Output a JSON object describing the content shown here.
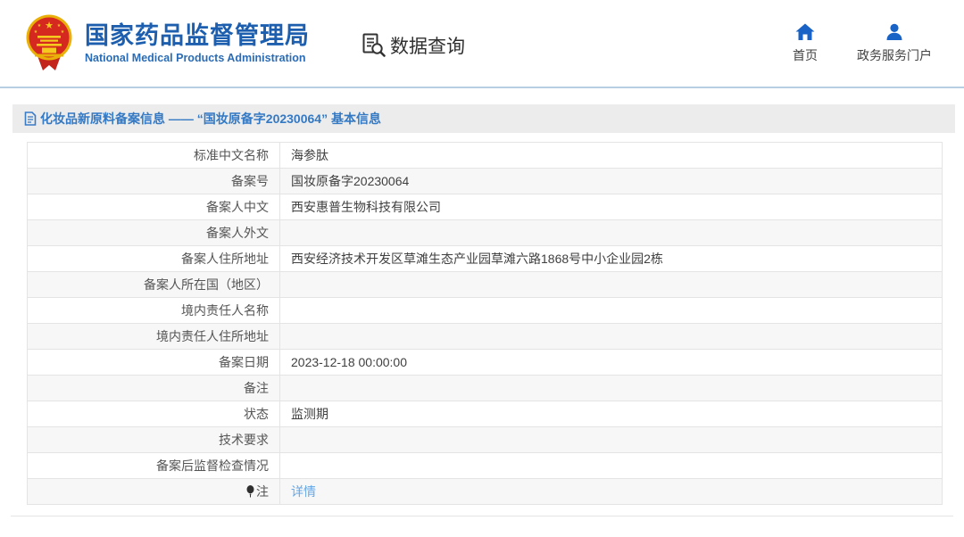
{
  "header": {
    "brand": {
      "title_cn": "国家药品监督管理局",
      "title_en": "National Medical Products Administration"
    },
    "query_title": "数据查询",
    "nav": [
      {
        "label": "首页",
        "icon": "home-icon"
      },
      {
        "label": "政务服务门户",
        "icon": "user-icon"
      }
    ]
  },
  "breadcrumb": {
    "title": "化妆品新原料备案信息 —— “国妆原备字20230064” 基本信息"
  },
  "table": {
    "rows": [
      {
        "label": "标准中文名称",
        "value": "海参肽"
      },
      {
        "label": "备案号",
        "value": "国妆原备字20230064"
      },
      {
        "label": "备案人中文",
        "value": "西安惠普生物科技有限公司"
      },
      {
        "label": "备案人外文",
        "value": ""
      },
      {
        "label": "备案人住所地址",
        "value": "西安经济技术开发区草滩生态产业园草滩六路1868号中小企业园2栋"
      },
      {
        "label": "备案人所在国（地区）",
        "value": ""
      },
      {
        "label": "境内责任人名称",
        "value": ""
      },
      {
        "label": "境内责任人住所地址",
        "value": ""
      },
      {
        "label": "备案日期",
        "value": "2023-12-18 00:00:00"
      },
      {
        "label": "备注",
        "value": ""
      },
      {
        "label": "状态",
        "value": "监测期"
      },
      {
        "label": "技术要求",
        "value": ""
      },
      {
        "label": "备案后监督检查情况",
        "value": ""
      },
      {
        "label": "注",
        "value": "详情",
        "value_is_link": true,
        "label_icon": "balloon-icon"
      }
    ]
  },
  "colors": {
    "brand_blue": "#1d5fae",
    "nav_icon_blue": "#1a63c6",
    "section_title_blue": "#3479c4",
    "link_blue": "#63a7e7",
    "header_rule_blue": "#b7cee3",
    "row_alt_gray": "#f7f7f7",
    "bar_gray": "#ececec"
  }
}
